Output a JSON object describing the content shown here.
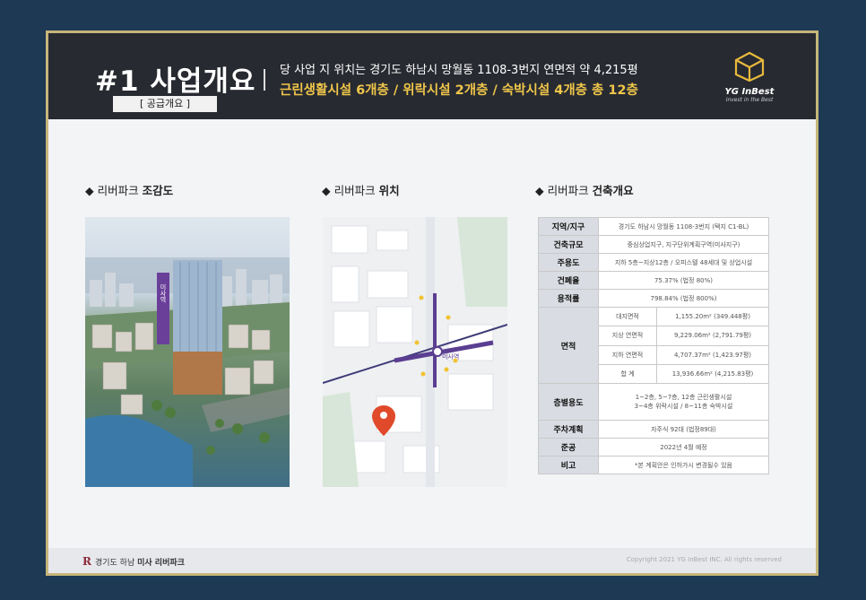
{
  "header": {
    "title": "#1 사업개요",
    "subtitle": "[ 공급개요 ]",
    "line1": "당 사업 지 위치는 경기도 하남시 망월동 1108-3번지 연면적 약 4,215평",
    "line2": "근린생활시설 6개층 / 위락시설 2개층 / 숙박시설 4개층 총 12층",
    "logo_name": "YG InBest",
    "logo_tagline": "Invest in the Best",
    "accent_color": "#f0c64a",
    "header_color": "#272a31"
  },
  "sections": {
    "render": {
      "prefix": "◆ 리버파크 ",
      "bold": "조감도"
    },
    "location": {
      "prefix": "◆ 리버파크 ",
      "bold": "위치"
    },
    "overview": {
      "prefix": "◆ 리버파크 ",
      "bold": "건축개요"
    }
  },
  "render_image": {
    "sign": "미사역"
  },
  "map": {
    "station": "미사역",
    "station_line_color": "#5b3e91",
    "pin_color": "#e04a2a"
  },
  "spec_table": {
    "rows": [
      {
        "k": "지역/지구",
        "v": "경기도 하남시 망월동 1108-3번지 (택지 C1-BL)"
      },
      {
        "k": "건축규모",
        "v": "중심상업지구, 지구단위계획구역(미사지구)"
      },
      {
        "k": "주용도",
        "v": "지하 5층~지상12층 / 오피스텔 48세대 및 상업시설"
      },
      {
        "k": "건폐율",
        "v": "75.37% (법정 80%)"
      },
      {
        "k": "용적률",
        "v": "798.84% (법정 800%)"
      }
    ],
    "area": {
      "k": "면적",
      "subs": [
        {
          "label": "대지면적",
          "value": "1,155.20m² (349.448평)"
        },
        {
          "label": "지상 연면적",
          "value": "9,229.06m² (2,791.79평)"
        },
        {
          "label": "지하 연면적",
          "value": "4,707.37m² (1,423.97평)"
        },
        {
          "label": "합 계",
          "value": "13,936.66m² (4,215.83평)"
        }
      ]
    },
    "floor_use": {
      "k": "층별용도",
      "v1": "1~2층, 5~7층, 12층 근린생활시설",
      "v2": "3~4층 위락시설 / 8~11층 숙박시설"
    },
    "rows2": [
      {
        "k": "주차계획",
        "v": "자주식 92대 (법정89대)"
      },
      {
        "k": "준공",
        "v": "2022년 4월 예정"
      },
      {
        "k": "비고",
        "v": "*본 계획안은 인허가시 변경될수 있음"
      }
    ]
  },
  "footer": {
    "logo_letter": "R",
    "left_prefix": "경기도 하남 ",
    "left_bold": "미사 리버파크",
    "copyright": "Copyright 2021 YG InBest INC. All rights reserved"
  }
}
